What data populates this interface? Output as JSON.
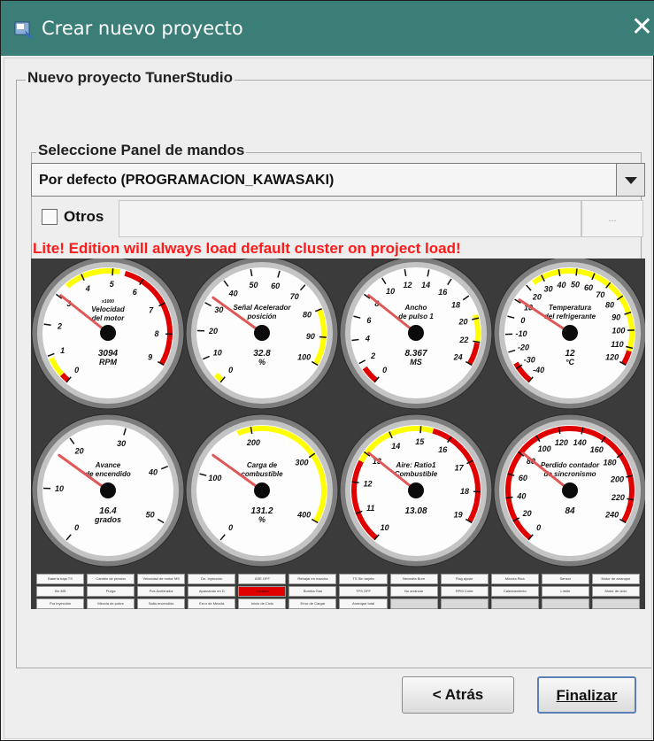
{
  "window": {
    "title": "Crear nuevo proyecto"
  },
  "project_group": {
    "title": "Nuevo proyecto TunerStudio"
  },
  "dashboard_group": {
    "title": "Seleccione Panel de mandos",
    "selected_dashboard": "Por defecto (PROGRAMACION_KAWASAKI)",
    "others_checkbox_label": "Otros",
    "others_checked": false,
    "others_path_value": "",
    "browse_label": "...",
    "lite_warning": "Lite! Edition will always load default cluster on project load!"
  },
  "gauges": [
    {
      "title1": "Velocidad",
      "title2": "del motor",
      "multiplier": "x1000",
      "value": "3094",
      "units": "RPM",
      "ticks": [
        "0",
        "1",
        "2",
        "3",
        "4",
        "5",
        "6",
        "7",
        "8",
        "9"
      ],
      "reading": 0.34,
      "yellow": [
        0.03,
        0.1,
        0.38,
        0.58
      ],
      "red": [
        0,
        0.03,
        0.6,
        1
      ]
    },
    {
      "title1": "Acelerador",
      "title2": "posición",
      "prefix": "Señal",
      "value": "32.8",
      "units": "%",
      "ticks": [
        "0",
        "10",
        "20",
        "30",
        "40",
        "50",
        "60",
        "70",
        "80",
        "90",
        "100"
      ],
      "reading": 0.33,
      "yellow": [
        0,
        0.03,
        0.8,
        1
      ],
      "red": []
    },
    {
      "title1": "Ancho",
      "title2": "de pulso 1",
      "value": "8.367",
      "units": "MS",
      "ticks": [
        "0",
        "2",
        "4",
        "6",
        "8",
        "10",
        "12",
        "14",
        "16",
        "18",
        "20",
        "22",
        "24"
      ],
      "reading": 0.34,
      "yellow": [
        0.82,
        0.92
      ],
      "red": [
        0,
        0.06,
        0.92,
        1
      ]
    },
    {
      "title1": "Temperatura",
      "title2": "del refrigerante",
      "value": "12",
      "units": "°C",
      "ticks": [
        "-40",
        "-30",
        "-20",
        "-10",
        "0",
        "10",
        "20",
        "30",
        "40",
        "50",
        "60",
        "70",
        "80",
        "90",
        "100",
        "110",
        "120"
      ],
      "reading": 0.32,
      "yellow": [
        0.4,
        0.95
      ],
      "red": [
        0,
        0.08,
        0.95,
        1
      ]
    },
    {
      "title1": "Avance",
      "title2": "de encendido",
      "value": "16.4",
      "units": "grados",
      "ticks": [
        "0",
        "10",
        "20",
        "30",
        "40",
        "50"
      ],
      "reading": 0.33,
      "yellow": [],
      "red": []
    },
    {
      "title1": "Carga de",
      "title2": "combustible",
      "value": "131.2",
      "units": "%",
      "ticks": [
        "0",
        "100",
        "200",
        "300",
        "400"
      ],
      "reading": 0.33,
      "yellow": [
        0.45,
        1
      ],
      "red": []
    },
    {
      "title1": "Aire: Ratio1",
      "title2": "Combustible",
      "value": "13.08",
      "units": "",
      "ticks": [
        "10",
        "11",
        "12",
        "13",
        "14",
        "15",
        "16",
        "17",
        "18",
        "19"
      ],
      "reading": 0.34,
      "yellow": [
        0.3,
        0.6
      ],
      "red": [
        0,
        0.3,
        0.6,
        1
      ]
    },
    {
      "title1": "Perdido contador",
      "title2": "de sincronismo",
      "value": "84",
      "units": "",
      "ticks": [
        "0",
        "20",
        "40",
        "60",
        "80",
        "100",
        "120",
        "140",
        "160",
        "180",
        "200",
        "220",
        "240"
      ],
      "reading": 0.34,
      "yellow": [],
      "red": [
        0,
        1
      ]
    }
  ],
  "indicators": [
    [
      "Batería baja TS",
      "Cambio de presión",
      "Velocidad de motor MS",
      "De. Inyección",
      "ASE OFF",
      "Rebajar en marcha",
      "TS Sin tarjeta",
      "Necesita Burn",
      "Flag ajuste",
      "Mezcla Rica",
      "Sensor",
      "Motor de arranque"
    ],
    [
      "Sin MS",
      "Purga",
      "Pos Acelerador",
      "Aparcando en D",
      "Cortada",
      "Bomba Gas",
      "TPS OFF",
      "No arrancar",
      "RPM Corte",
      "Calentamiento",
      "Límite",
      "Motor de ciclo"
    ],
    [
      "Por inyección",
      "Mezcla de pobre",
      "Salto encendido",
      "Error de Mezcla",
      "Inicio de Ciclo",
      "Error de Cargar",
      "Arranque total",
      "",
      "",
      "",
      "",
      ""
    ]
  ],
  "indicator_states": [
    [
      "on",
      "on",
      "on",
      "on",
      "on",
      "on",
      "on",
      "on",
      "on",
      "on",
      "on",
      "on"
    ],
    [
      "on",
      "on",
      "on",
      "on",
      "red",
      "on",
      "on",
      "on",
      "on",
      "on",
      "on",
      "on"
    ],
    [
      "on",
      "on",
      "on",
      "on",
      "on",
      "on",
      "on",
      "off",
      "off",
      "off",
      "off",
      "off"
    ]
  ],
  "buttons": {
    "back": "< Atrás",
    "finish": "Finalizar"
  },
  "colors": {
    "titlebar": "#3a7e77",
    "warning": "#ff1a1a",
    "needle": "#e05757",
    "yellow_band": "#ffff00",
    "red_band": "#e00000"
  }
}
